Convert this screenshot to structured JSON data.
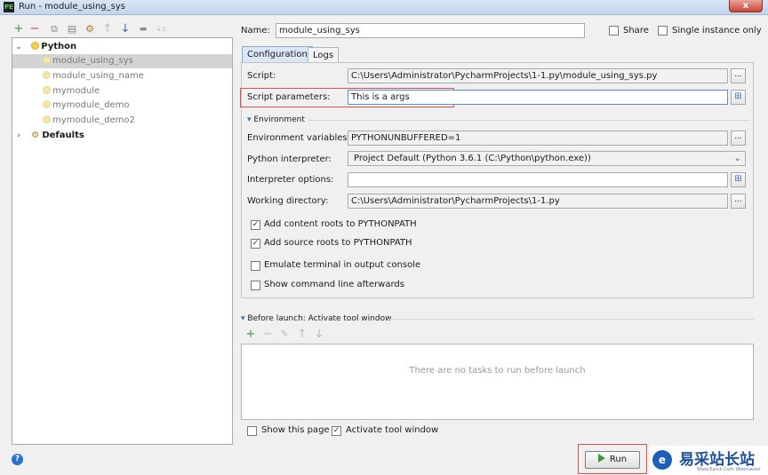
{
  "window": {
    "title": "Run - module_using_sys",
    "app_icon": "PE",
    "close_label": "x"
  },
  "toolbar": {
    "add": "+",
    "remove": "−",
    "copy": "⧉",
    "save": "▤",
    "wrench": "⚙",
    "up": "↑",
    "down": "↓",
    "folder": "▬",
    "sort": "↓z"
  },
  "tree": {
    "python": {
      "label": "Python",
      "chevron": "⌄"
    },
    "items": [
      "module_using_sys",
      "module_using_name",
      "mymodule",
      "mymodule_demo",
      "mymodule_demo2"
    ],
    "defaults": {
      "label": "Defaults",
      "chevron": "›"
    }
  },
  "header": {
    "name_label": "Name:",
    "name_value": "module_using_sys",
    "share_label": "Share",
    "single_instance_label": "Single instance only"
  },
  "tabs": [
    "Configuration",
    "Logs"
  ],
  "config": {
    "script_label": "Script:",
    "script_value": "C:\\Users\\Administrator\\PycharmProjects\\1-1.py\\module_using_sys.py",
    "params_label": "Script parameters:",
    "params_value": "This is a args",
    "environment_label": "Environment",
    "env_vars_label": "Environment variables:",
    "env_vars_value": "PYTHONUNBUFFERED=1",
    "interpreter_label": "Python interpreter:",
    "interpreter_value": "Project Default (Python 3.6.1 (C:\\Python\\python.exe))",
    "interp_options_label": "Interpreter options:",
    "interp_options_value": "",
    "workdir_label": "Working directory:",
    "workdir_value": "C:\\Users\\Administrator\\PycharmProjects\\1-1.py",
    "dots": "...",
    "add_content_roots": "Add content roots to PYTHONPATH",
    "add_source_roots": "Add source roots to PYTHONPATH",
    "emulate_terminal": "Emulate terminal in output console",
    "show_command_line": "Show command line afterwards"
  },
  "before_launch": {
    "title": "Before launch: Activate tool window",
    "empty_text": "There are no tasks to run before launch"
  },
  "footer": {
    "show_page_label": "Show this page",
    "activate_tool_label": "Activate tool window",
    "run_label": "Run",
    "help": "?"
  },
  "watermark": {
    "cn": "易采站长站",
    "en": "Www.Easck.Com Webmaster"
  }
}
